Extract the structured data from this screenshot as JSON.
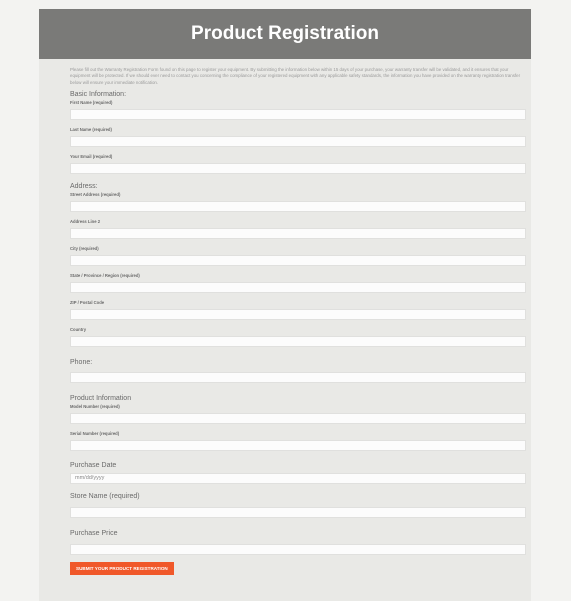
{
  "banner": {
    "title": "Product Registration"
  },
  "intro": "Please fill out the Warranty Registration Form found on this page to register your equipment. By submitting the information below within 15 days of your purchase, your warranty transfer will be validated, and it ensures that your equipment will be protected. If we should ever need to contact you concerning the compliance of your registered equipment with any applicable safety standards, the information you have provided on the warranty registration transfer below will ensure your immediate notification.",
  "sections": {
    "basic": "Basic Information:",
    "address": "Address:",
    "phone": "Phone:",
    "product": "Product Information",
    "purchase_date": "Purchase Date",
    "store_name": "Store Name (required)",
    "purchase_price": "Purchase Price"
  },
  "fields": {
    "first_name": "First Name (required)",
    "last_name": "Last Name (required)",
    "email": "Your Email (required)",
    "street": "Street Address (required)",
    "address2": "Address Line 2",
    "city": "City (required)",
    "state": "State / Province / Region (required)",
    "zip": "ZIP / Postal Code",
    "country": "Country",
    "model": "Model Number (required)",
    "serial": "Serial Number (required)"
  },
  "purchase_date_placeholder": "mm/dd/yyyy",
  "submit_label": "SUBMIT YOUR PRODUCT REGISTRATION",
  "colors": {
    "banner": "#7a7a78",
    "accent": "#f0582a"
  }
}
